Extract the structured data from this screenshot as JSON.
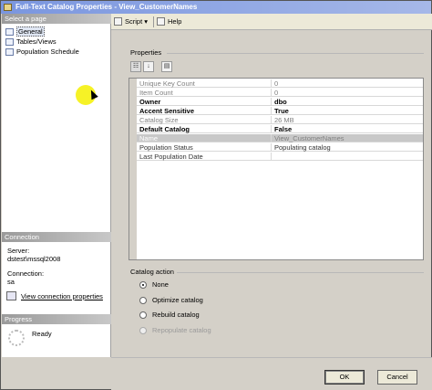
{
  "window": {
    "title": "Full-Text Catalog Properties - View_CustomerNames"
  },
  "left_pane": {
    "select_page_header": "Select a page",
    "pages": [
      {
        "label": "General",
        "selected": true
      },
      {
        "label": "Tables/Views",
        "selected": false
      },
      {
        "label": "Population Schedule",
        "selected": false
      }
    ],
    "connection_header": "Connection",
    "server_label": "Server:",
    "server_value": "dstest\\mssql2008",
    "connection_label": "Connection:",
    "connection_value": "sa",
    "view_connection_link": "View connection properties",
    "progress_header": "Progress",
    "progress_status": "Ready"
  },
  "toolbar": {
    "script_label": "Script",
    "help_label": "Help"
  },
  "properties": {
    "legend": "Properties",
    "rows": [
      {
        "name": "Unique Key Count",
        "value": "0",
        "style": "readonly"
      },
      {
        "name": "Item Count",
        "value": "0",
        "style": "readonly"
      },
      {
        "name": "Owner",
        "value": "dbo",
        "style": "bold"
      },
      {
        "name": "Accent Sensitive",
        "value": "True",
        "style": "bold"
      },
      {
        "name": "Catalog Size",
        "value": "26 MB",
        "style": "readonly"
      },
      {
        "name": "Default Catalog",
        "value": "False",
        "style": "bold"
      },
      {
        "name": "Name",
        "value": "View_CustomerNames",
        "style": "selected"
      },
      {
        "name": "Population Status",
        "value": "Populating catalog",
        "style": "normal"
      },
      {
        "name": "Last Population Date",
        "value": "",
        "style": "normal"
      }
    ]
  },
  "catalog_action": {
    "legend": "Catalog action",
    "options": [
      {
        "label": "None",
        "checked": true,
        "disabled": false
      },
      {
        "label": "Optimize catalog",
        "checked": false,
        "disabled": false
      },
      {
        "label": "Rebuild catalog",
        "checked": false,
        "disabled": false
      },
      {
        "label": "Repopulate catalog",
        "checked": false,
        "disabled": true
      }
    ]
  },
  "buttons": {
    "ok": "OK",
    "cancel": "Cancel"
  }
}
